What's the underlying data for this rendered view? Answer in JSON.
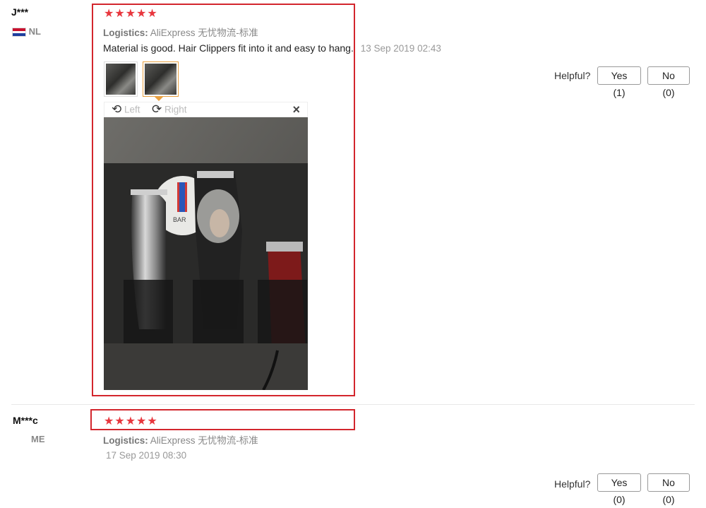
{
  "reviews": [
    {
      "user": "J***",
      "country": "NL",
      "stars": "★★★★★",
      "logistics_label": "Logistics:",
      "logistics_value": "AliExpress 无忧物流-标准",
      "text": "Material is good. Hair Clippers fit into it and easy to hang.",
      "date": "13 Sep 2019 02:43",
      "helpful_label": "Helpful?",
      "yes_label": "Yes (1)",
      "no_label": "No (0)",
      "viewer": {
        "left_label": "Left",
        "right_label": "Right",
        "close_icon": "×",
        "photo_text": "BAR"
      }
    },
    {
      "user": "M***c",
      "country": "ME",
      "stars": "★★★★★",
      "logistics_label": "Logistics:",
      "logistics_value": "AliExpress 无忧物流-标准",
      "date": "17 Sep 2019 08:30",
      "helpful_label": "Helpful?",
      "yes_label": "Yes (0)",
      "no_label": "No (0)"
    }
  ],
  "colors": {
    "star": "#e8373e",
    "highlight_box": "#d3262d",
    "active_thumb": "#e8a040"
  }
}
